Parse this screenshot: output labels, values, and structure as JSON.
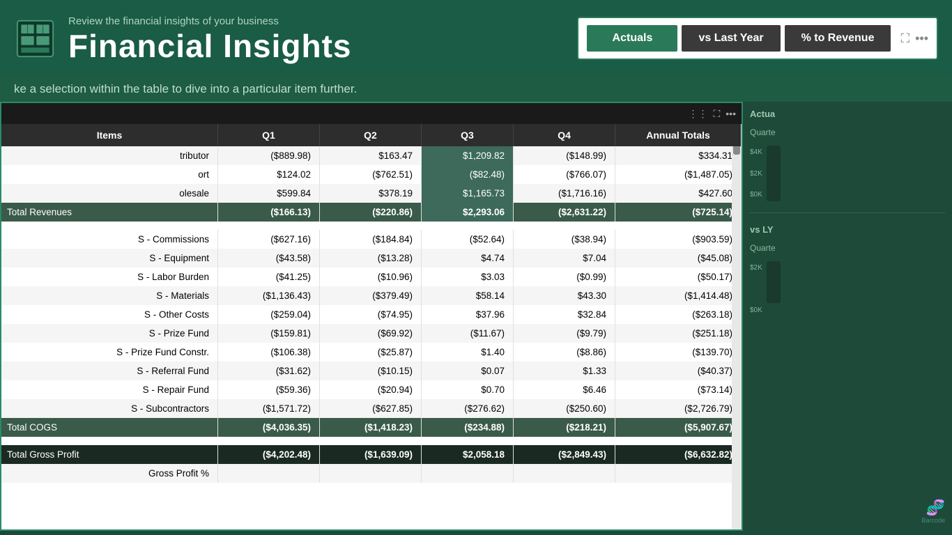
{
  "header": {
    "subtitle": "Review the financial insights of your business",
    "title": "Financial Insights"
  },
  "toggle": {
    "buttons": [
      {
        "label": "Actuals",
        "state": "active"
      },
      {
        "label": "vs Last Year",
        "state": "inactive"
      },
      {
        "label": "% to Revenue",
        "state": "inactive"
      }
    ]
  },
  "subtitle_bar": {
    "text": "ke a selection within the table to dive into a particular item further."
  },
  "table": {
    "columns": [
      "Items",
      "Q1",
      "Q2",
      "Q3",
      "Q4",
      "Annual Totals"
    ],
    "rows": [
      {
        "label": "tributor",
        "q1": "($889.98)",
        "q2": "$163.47",
        "q3": "$1,209.82",
        "q4": "($148.99)",
        "annual": "$334.31",
        "type": "normal"
      },
      {
        "label": "ort",
        "q1": "$124.02",
        "q2": "($762.51)",
        "q3": "($82.48)",
        "q4": "($766.07)",
        "annual": "($1,487.05)",
        "type": "normal"
      },
      {
        "label": "olesale",
        "q1": "$599.84",
        "q2": "$378.19",
        "q3": "$1,165.73",
        "q4": "($1,716.16)",
        "annual": "$427.60",
        "type": "normal"
      },
      {
        "label": "Total Revenues",
        "q1": "($166.13)",
        "q2": "($220.86)",
        "q3": "$2,293.06",
        "q4": "($2,631.22)",
        "annual": "($725.14)",
        "type": "total"
      },
      {
        "label": "",
        "q1": "",
        "q2": "",
        "q3": "",
        "q4": "",
        "annual": "",
        "type": "spacer"
      },
      {
        "label": "S - Commissions",
        "q1": "($627.16)",
        "q2": "($184.84)",
        "q3": "($52.64)",
        "q4": "($38.94)",
        "annual": "($903.59)",
        "type": "indent"
      },
      {
        "label": "S - Equipment",
        "q1": "($43.58)",
        "q2": "($13.28)",
        "q3": "$4.74",
        "q4": "$7.04",
        "annual": "($45.08)",
        "type": "indent"
      },
      {
        "label": "S - Labor Burden",
        "q1": "($41.25)",
        "q2": "($10.96)",
        "q3": "$3.03",
        "q4": "($0.99)",
        "annual": "($50.17)",
        "type": "indent"
      },
      {
        "label": "S - Materials",
        "q1": "($1,136.43)",
        "q2": "($379.49)",
        "q3": "$58.14",
        "q4": "$43.30",
        "annual": "($1,414.48)",
        "type": "indent"
      },
      {
        "label": "S - Other Costs",
        "q1": "($259.04)",
        "q2": "($74.95)",
        "q3": "$37.96",
        "q4": "$32.84",
        "annual": "($263.18)",
        "type": "indent"
      },
      {
        "label": "S - Prize Fund",
        "q1": "($159.81)",
        "q2": "($69.92)",
        "q3": "($11.67)",
        "q4": "($9.79)",
        "annual": "($251.18)",
        "type": "indent"
      },
      {
        "label": "S - Prize Fund Constr.",
        "q1": "($106.38)",
        "q2": "($25.87)",
        "q3": "$1.40",
        "q4": "($8.86)",
        "annual": "($139.70)",
        "type": "indent"
      },
      {
        "label": "S - Referral Fund",
        "q1": "($31.62)",
        "q2": "($10.15)",
        "q3": "$0.07",
        "q4": "$1.33",
        "annual": "($40.37)",
        "type": "indent"
      },
      {
        "label": "S - Repair Fund",
        "q1": "($59.36)",
        "q2": "($20.94)",
        "q3": "$0.70",
        "q4": "$6.46",
        "annual": "($73.14)",
        "type": "indent"
      },
      {
        "label": "S - Subcontractors",
        "q1": "($1,571.72)",
        "q2": "($627.85)",
        "q3": "($276.62)",
        "q4": "($250.60)",
        "annual": "($2,726.79)",
        "type": "indent"
      },
      {
        "label": "Total COGS",
        "q1": "($4,036.35)",
        "q2": "($1,418.23)",
        "q3": "($234.88)",
        "q4": "($218.21)",
        "annual": "($5,907.67)",
        "type": "total"
      },
      {
        "label": "",
        "q1": "",
        "q2": "",
        "q3": "",
        "q4": "",
        "annual": "",
        "type": "spacer"
      },
      {
        "label": "Total Gross Profit",
        "q1": "($4,202.48)",
        "q2": "($1,639.09)",
        "q3": "$2,058.18",
        "q4": "($2,849.43)",
        "annual": "($6,632.82)",
        "type": "total-dark"
      },
      {
        "label": "Gross Profit %",
        "q1": "",
        "q2": "",
        "q3": "",
        "q4": "",
        "annual": "",
        "type": "normal"
      }
    ]
  },
  "right_panel": {
    "actuals_label": "Actua",
    "quarter_label": "Quarte",
    "value_4k": "$4K",
    "value_2k": "$2K",
    "value_0k": "$0K",
    "vs_ly_label": "vs LY",
    "quarter_label2": "Quarte",
    "value_neg_2k": "$2K",
    "value_neg_ok": "$0K"
  },
  "colors": {
    "header_bg": "#1e5c45",
    "table_header_bg": "#2d2d2d",
    "total_row_bg": "#2a2a2a",
    "selected_row_bg": "#5a8a7a",
    "highlight_q3": "#4a7a6a",
    "accent_green": "#2a8a6a",
    "border_blue": "#2a6aaa"
  }
}
